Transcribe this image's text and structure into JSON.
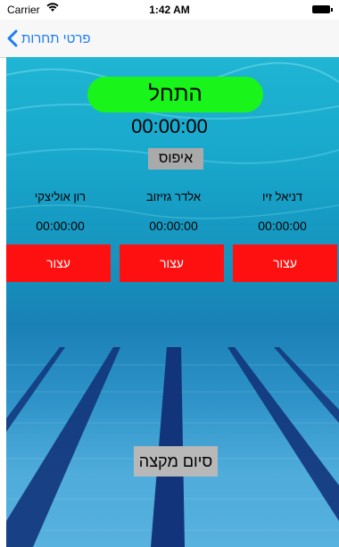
{
  "status_bar": {
    "carrier": "Carrier",
    "time": "1:42 AM"
  },
  "nav": {
    "back_label": "פרטי תחרות"
  },
  "start_button": {
    "label": "התחל",
    "color": "#19f51a"
  },
  "main_timer": "00:00:00",
  "reset_button": {
    "label": "איפוס"
  },
  "swimmers": [
    {
      "name": "רון אוליצקי",
      "time": "00:00:00",
      "stop_label": "עצור"
    },
    {
      "name": "אלדר גזיזוב",
      "time": "00:00:00",
      "stop_label": "עצור"
    },
    {
      "name": "דניאל זיו",
      "time": "00:00:00",
      "stop_label": "עצור"
    }
  ],
  "stop_color": "#ff1010",
  "end_heat_button": {
    "label": "סיום מקצה"
  },
  "icons": {
    "wifi": "wifi-icon",
    "battery": "battery-icon",
    "back": "chevron-left-icon"
  }
}
